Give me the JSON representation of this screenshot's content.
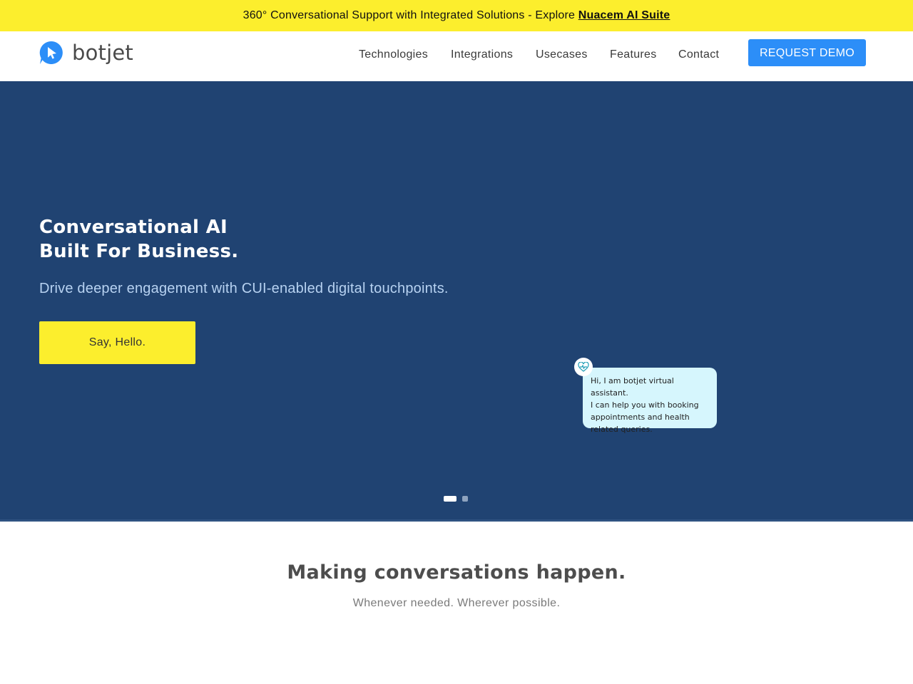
{
  "announcement": {
    "text": "360° Conversational Support with Integrated Solutions - Explore ",
    "link": "Nuacem AI Suite"
  },
  "brand": {
    "name": "botjet",
    "logo_icon": "pointer-bubble-icon"
  },
  "nav": {
    "items": [
      "Technologies",
      "Integrations",
      "Usecases",
      "Features",
      "Contact"
    ],
    "cta": "REQUEST DEMO"
  },
  "hero": {
    "title_line1": "Conversational AI",
    "title_line2": "Built For Business.",
    "subtitle": "Drive deeper engagement with CUI-enabled digital touchpoints.",
    "cta": "Say, Hello.",
    "chat": {
      "avatar_icon": "heartbeat-icon",
      "lines": [
        "Hi, I am botjet virtual assistant.",
        "I can help you with booking",
        "appointments and health",
        "related queries."
      ]
    },
    "slides_total": 2,
    "slide_active": 1
  },
  "section": {
    "title": "Making conversations happen.",
    "subtitle": "Whenever needed. Wherever possible."
  },
  "colors": {
    "announce_bg": "#fcee2d",
    "hero_bg": "#204372",
    "cta_blue": "#2c8ef8",
    "bubble_bg": "#d6f6fd"
  }
}
